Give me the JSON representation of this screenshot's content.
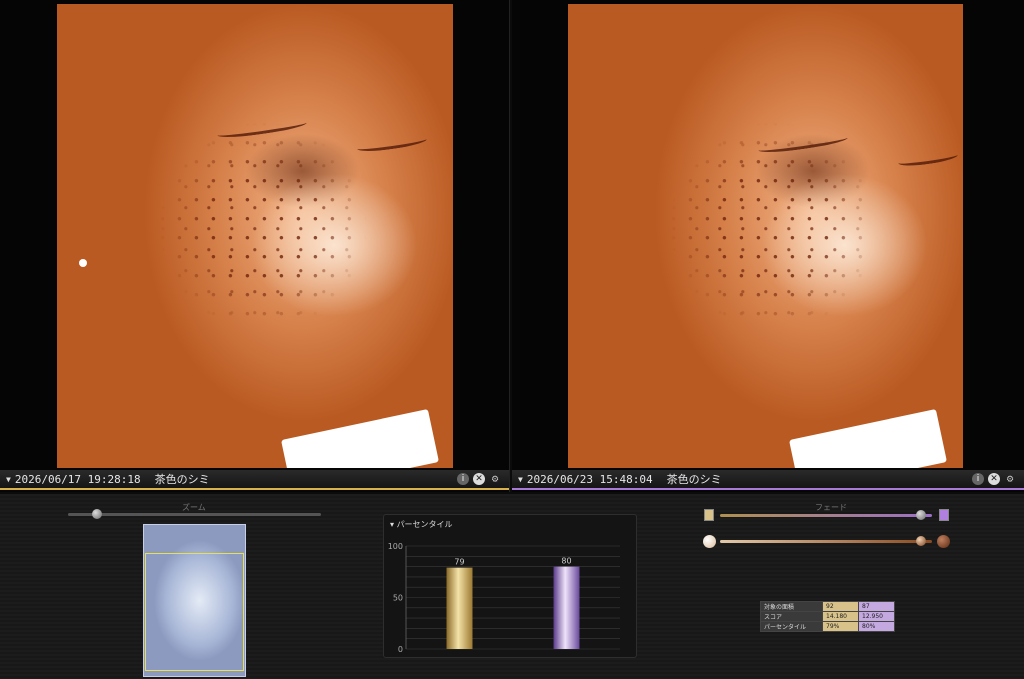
{
  "viewers": {
    "left": {
      "timestamp": "2026/06/17 19:28:18",
      "label": "茶色のシミ",
      "accent": "#d9b24a"
    },
    "right": {
      "timestamp": "2026/06/23 15:48:04",
      "label": "茶色のシミ",
      "accent": "#a77bd6"
    }
  },
  "viewer_icons": [
    "info-icon",
    "close-icon",
    "settings-icon"
  ],
  "zoom": {
    "label": "ズーム",
    "value": 0.1
  },
  "fade": {
    "label": "フェード",
    "value": 0.97,
    "brightness": 0.97
  },
  "chart_data": {
    "type": "bar",
    "title": "パーセンタイル",
    "categories": [
      "2026/06/17 19:28:18",
      "2026/06/23 15:48:04"
    ],
    "values": [
      79,
      80
    ],
    "ylim": [
      0,
      100
    ],
    "yticks": [
      0,
      50,
      100
    ],
    "colors": [
      "#c9a24a",
      "#9b6fd0"
    ]
  },
  "table": {
    "rows": [
      {
        "label": "対象の面積",
        "a": "92",
        "b": "87"
      },
      {
        "label": "スコア",
        "a": "14.180",
        "b": "12.950"
      },
      {
        "label": "パーセンタイル",
        "a": "79%",
        "b": "80%"
      }
    ]
  }
}
